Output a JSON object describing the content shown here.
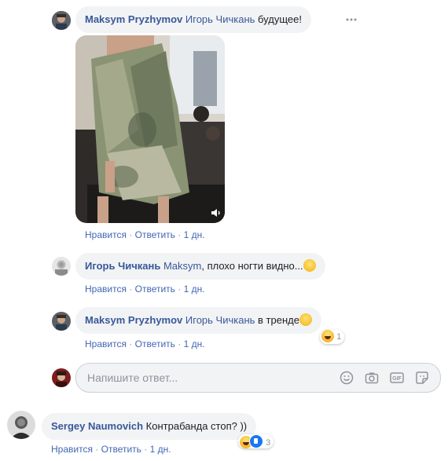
{
  "comments": [
    {
      "author": "Maksym Pryzhymov",
      "mention": "Игорь Чичкань",
      "text": " будущее!",
      "actions": {
        "like": "Нравится",
        "reply": "Ответить",
        "time": "1 дн."
      }
    },
    {
      "author": "Игорь Чичкань",
      "mention": "Maksym",
      "text": ", плохо ногти видно...",
      "actions": {
        "like": "Нравится",
        "reply": "Ответить",
        "time": "1 дн."
      }
    },
    {
      "author": "Maksym Pryzhymov",
      "mention": "Игорь Чичкань",
      "text": " в тренде",
      "reactions": {
        "count": "1",
        "types": [
          "haha"
        ]
      },
      "actions": {
        "like": "Нравится",
        "reply": "Ответить",
        "time": "1 дн."
      }
    },
    {
      "author": "Sergey Naumovich",
      "text": "Контрабанда стоп? ))",
      "reactions": {
        "count": "3",
        "types": [
          "haha",
          "like"
        ]
      },
      "actions": {
        "like": "Нравится",
        "reply": "Ответить",
        "time": "1 дн."
      }
    }
  ],
  "reply_box": {
    "placeholder": "Напишите ответ..."
  },
  "separator": " · ",
  "more_icon": "more-options-icon",
  "colors": {
    "link": "#385898",
    "bubble": "#f2f3f5",
    "meta": "#90949c",
    "like_blue": "#1877f2"
  }
}
